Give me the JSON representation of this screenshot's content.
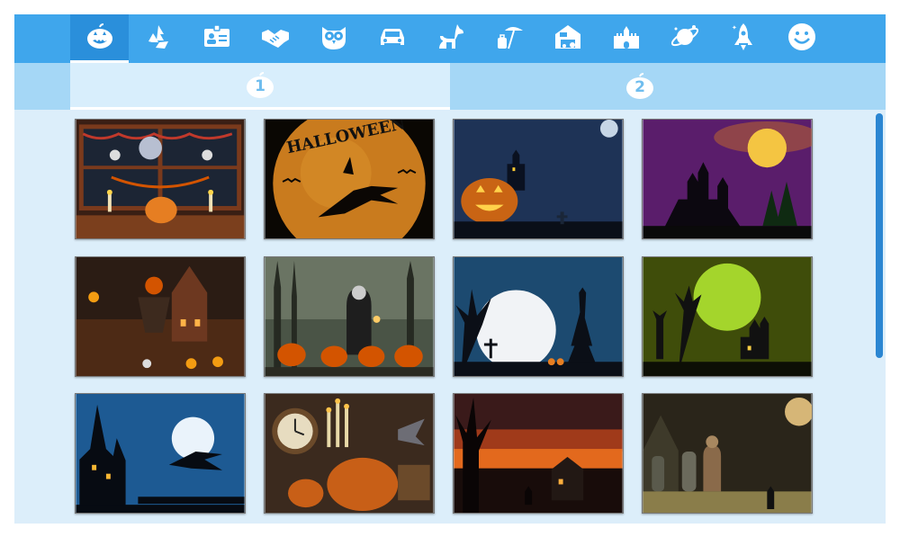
{
  "app": {
    "category_tabs": [
      {
        "icon": "pumpkin-icon",
        "active": true
      },
      {
        "icon": "recycle-icon",
        "active": false
      },
      {
        "icon": "id-card-icon",
        "active": false
      },
      {
        "icon": "handshake-icon",
        "active": false
      },
      {
        "icon": "owl-icon",
        "active": false
      },
      {
        "icon": "car-icon",
        "active": false
      },
      {
        "icon": "pets-icon",
        "active": false
      },
      {
        "icon": "beach-icon",
        "active": false
      },
      {
        "icon": "farm-barn-icon",
        "active": false
      },
      {
        "icon": "castle-icon",
        "active": false
      },
      {
        "icon": "space-planet-icon",
        "active": false
      },
      {
        "icon": "rocket-icon",
        "active": false
      },
      {
        "icon": "smiley-icon",
        "active": false
      }
    ],
    "page_tabs": [
      {
        "label": "1",
        "active": true
      },
      {
        "label": "2",
        "active": false
      }
    ],
    "gallery": {
      "images": [
        "halloween-party-room-scene",
        "witch-flying-over-halloween-moon",
        "jack-o-lantern-haunted-castle-night",
        "haunted-castle-purple-sky-full-moon",
        "scarecrow-haunted-house-pumpkin-patch",
        "nun-with-lantern-pumpkins-forest",
        "full-moon-graveyard-spooky-tree",
        "devil-haunted-house-green-moon",
        "witch-silhouette-blue-moon-castle",
        "clock-candles-giant-pumpkin-room",
        "sunset-haunted-house-zombie",
        "zombie-graveyard-moon-night"
      ]
    }
  },
  "colors": {
    "tab_bar": "#3fa6ec",
    "tab_active": "#2a8fdb",
    "page_bar": "#a5d7f6",
    "content_bg": "#dceefa",
    "scrollbar": "#2b86d2"
  }
}
